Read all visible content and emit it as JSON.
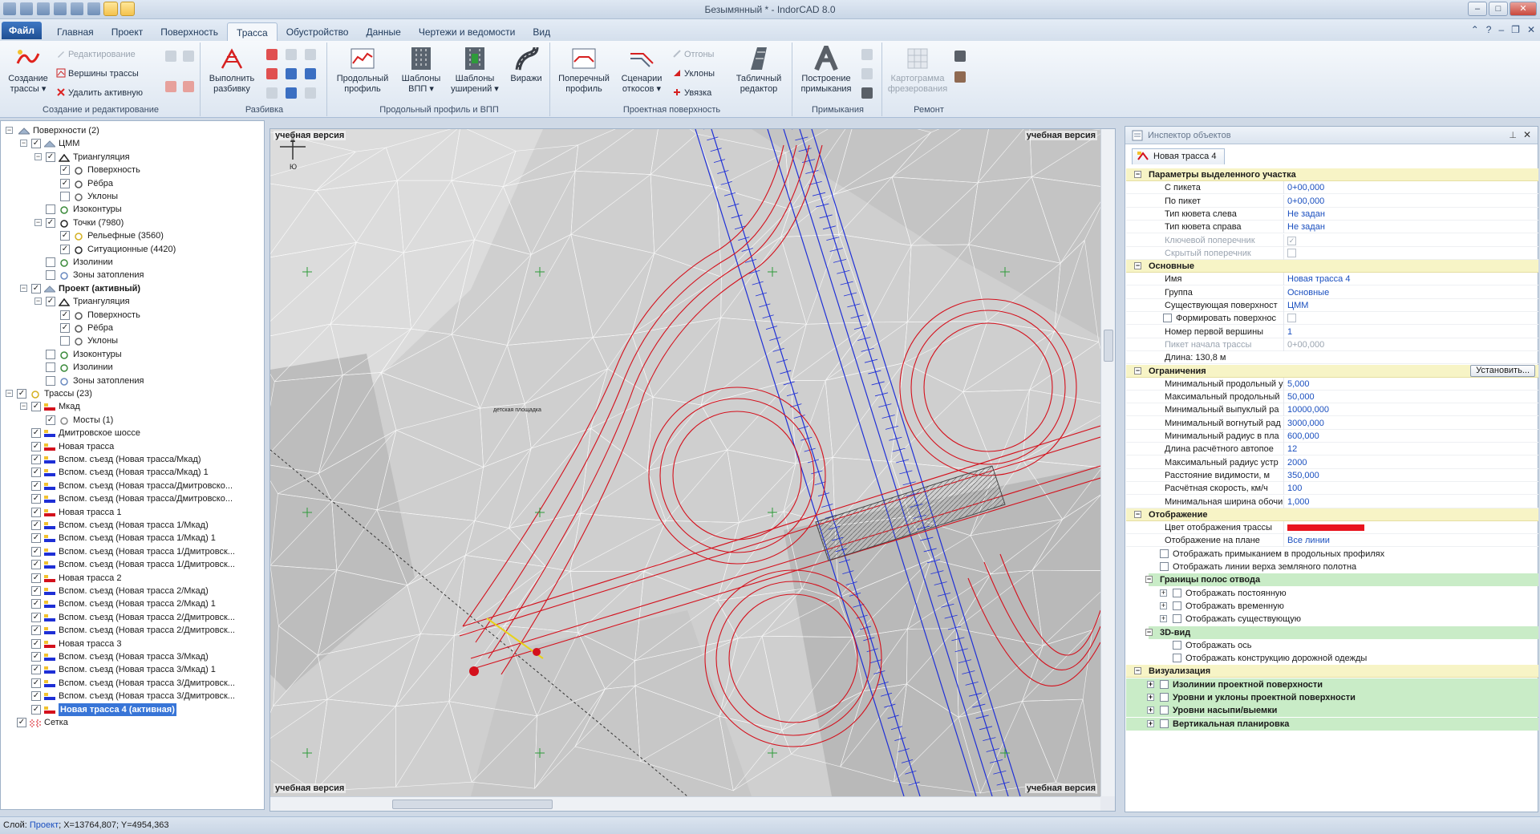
{
  "window": {
    "title": "Безымянный * - IndorCAD 8.0"
  },
  "menu": {
    "file": "Файл",
    "tabs": [
      "Главная",
      "Проект",
      "Поверхность",
      "Трасса",
      "Обустройство",
      "Данные",
      "Чертежи и ведомости",
      "Вид"
    ],
    "active": "Трасса"
  },
  "ribbon": {
    "g1": {
      "label": "Создание и редактирование",
      "create": "Создание трассы",
      "create_arrow": "▾",
      "edit": "Редактирование",
      "vertices": "Вершины трассы",
      "delete": "Удалить активную"
    },
    "g2": {
      "label": "Разбивка",
      "run": "Выполнить разбивку"
    },
    "g3": {
      "label": "Продольный профиль и ВПП",
      "long": "Продольный профиль",
      "tmpl_vpp": "Шаблоны ВПП",
      "tmpl_wide": "Шаблоны уширений",
      "turns": "Виражи"
    },
    "g4": {
      "label": "Проектная поверхность",
      "cross": "Поперечный профиль",
      "scenario": "Сценарии откосов",
      "otgony": "Отгоны",
      "uklony": "Уклоны",
      "uvyazka": "Увязка",
      "table": "Табличный редактор"
    },
    "g5": {
      "label": "Примыкания",
      "build": "Построение примыкания"
    },
    "g6": {
      "label": "Ремонт",
      "carto": "Картограмма фрезерования"
    }
  },
  "tree": [
    {
      "level": 0,
      "exp": "-",
      "cb": "",
      "icon": "surface",
      "label": "Поверхности (2)"
    },
    {
      "level": 1,
      "exp": "-",
      "cb": "✓",
      "icon": "dtm",
      "label": "ЦММ"
    },
    {
      "level": 2,
      "exp": "-",
      "cb": "✓",
      "icon": "tri",
      "label": "Триангуляция"
    },
    {
      "level": 3,
      "exp": "",
      "cb": "✓",
      "icon": "surf",
      "label": "Поверхность"
    },
    {
      "level": 3,
      "exp": "",
      "cb": "✓",
      "icon": "edges",
      "label": "Рёбра"
    },
    {
      "level": 3,
      "exp": "",
      "cb": "",
      "icon": "slopes",
      "label": "Уклоны"
    },
    {
      "level": 2,
      "exp": "",
      "cb": "",
      "icon": "contour",
      "label": "Изоконтуры"
    },
    {
      "level": 2,
      "exp": "-",
      "cb": "✓",
      "icon": "points",
      "label": "Точки (7980)"
    },
    {
      "level": 3,
      "exp": "",
      "cb": "✓",
      "icon": "relief",
      "label": "Рельефные (3560)"
    },
    {
      "level": 3,
      "exp": "",
      "cb": "✓",
      "icon": "situation",
      "label": "Ситуационные (4420)"
    },
    {
      "level": 2,
      "exp": "",
      "cb": "",
      "icon": "contour",
      "label": "Изолинии"
    },
    {
      "level": 2,
      "exp": "",
      "cb": "",
      "icon": "flood",
      "label": "Зоны затопления"
    },
    {
      "level": 1,
      "exp": "-",
      "cb": "✓",
      "icon": "dtm",
      "label": "Проект (активный)",
      "bold": true
    },
    {
      "level": 2,
      "exp": "-",
      "cb": "✓",
      "icon": "tri",
      "label": "Триангуляция"
    },
    {
      "level": 3,
      "exp": "",
      "cb": "✓",
      "icon": "surf",
      "label": "Поверхность"
    },
    {
      "level": 3,
      "exp": "",
      "cb": "✓",
      "icon": "edges",
      "label": "Рёбра"
    },
    {
      "level": 3,
      "exp": "",
      "cb": "",
      "icon": "slopes",
      "label": "Уклоны"
    },
    {
      "level": 2,
      "exp": "",
      "cb": "",
      "icon": "contour",
      "label": "Изоконтуры"
    },
    {
      "level": 2,
      "exp": "",
      "cb": "",
      "icon": "contour",
      "label": "Изолинии"
    },
    {
      "level": 2,
      "exp": "",
      "cb": "",
      "icon": "flood",
      "label": "Зоны затопления"
    },
    {
      "level": 0,
      "exp": "-",
      "cb": "✓",
      "icon": "roads",
      "label": "Трассы (23)"
    },
    {
      "level": 1,
      "exp": "-",
      "cb": "✓",
      "icon": "road-red",
      "label": "Мкад"
    },
    {
      "level": 2,
      "exp": "",
      "cb": "✓",
      "icon": "bridge",
      "label": "Мосты (1)"
    },
    {
      "level": 1,
      "exp": "",
      "cb": "✓",
      "icon": "road-blue",
      "label": "Дмитровское шоссе"
    },
    {
      "level": 1,
      "exp": "",
      "cb": "✓",
      "icon": "road-red",
      "label": "Новая трасса"
    },
    {
      "level": 1,
      "exp": "",
      "cb": "✓",
      "icon": "road-blue",
      "label": "Вспом. съезд (Новая трасса/Мкад)"
    },
    {
      "level": 1,
      "exp": "",
      "cb": "✓",
      "icon": "road-blue",
      "label": "Вспом. съезд (Новая трасса/Мкад) 1"
    },
    {
      "level": 1,
      "exp": "",
      "cb": "✓",
      "icon": "road-blue",
      "label": "Вспом. съезд (Новая трасса/Дмитровско..."
    },
    {
      "level": 1,
      "exp": "",
      "cb": "✓",
      "icon": "road-blue",
      "label": "Вспом. съезд (Новая трасса/Дмитровско..."
    },
    {
      "level": 1,
      "exp": "",
      "cb": "✓",
      "icon": "road-red",
      "label": "Новая трасса 1"
    },
    {
      "level": 1,
      "exp": "",
      "cb": "✓",
      "icon": "road-blue",
      "label": "Вспом. съезд (Новая трасса 1/Мкад)"
    },
    {
      "level": 1,
      "exp": "",
      "cb": "✓",
      "icon": "road-blue",
      "label": "Вспом. съезд (Новая трасса 1/Мкад) 1"
    },
    {
      "level": 1,
      "exp": "",
      "cb": "✓",
      "icon": "road-blue",
      "label": "Вспом. съезд (Новая трасса 1/Дмитровск..."
    },
    {
      "level": 1,
      "exp": "",
      "cb": "✓",
      "icon": "road-blue",
      "label": "Вспом. съезд (Новая трасса 1/Дмитровск..."
    },
    {
      "level": 1,
      "exp": "",
      "cb": "✓",
      "icon": "road-red",
      "label": "Новая трасса 2"
    },
    {
      "level": 1,
      "exp": "",
      "cb": "✓",
      "icon": "road-blue",
      "label": "Вспом. съезд (Новая трасса 2/Мкад)"
    },
    {
      "level": 1,
      "exp": "",
      "cb": "✓",
      "icon": "road-blue",
      "label": "Вспом. съезд (Новая трасса 2/Мкад) 1"
    },
    {
      "level": 1,
      "exp": "",
      "cb": "✓",
      "icon": "road-blue",
      "label": "Вспом. съезд (Новая трасса 2/Дмитровск..."
    },
    {
      "level": 1,
      "exp": "",
      "cb": "✓",
      "icon": "road-blue",
      "label": "Вспом. съезд (Новая трасса 2/Дмитровск..."
    },
    {
      "level": 1,
      "exp": "",
      "cb": "✓",
      "icon": "road-red",
      "label": "Новая трасса 3"
    },
    {
      "level": 1,
      "exp": "",
      "cb": "✓",
      "icon": "road-blue",
      "label": "Вспом. съезд (Новая трасса 3/Мкад)"
    },
    {
      "level": 1,
      "exp": "",
      "cb": "✓",
      "icon": "road-blue",
      "label": "Вспом. съезд (Новая трасса 3/Мкад) 1"
    },
    {
      "level": 1,
      "exp": "",
      "cb": "✓",
      "icon": "road-blue",
      "label": "Вспом. съезд (Новая трасса 3/Дмитровск..."
    },
    {
      "level": 1,
      "exp": "",
      "cb": "✓",
      "icon": "road-blue",
      "label": "Вспом. съезд (Новая трасса 3/Дмитровск..."
    },
    {
      "level": 1,
      "exp": "",
      "cb": "✓",
      "icon": "road-red",
      "label": "Новая трасса 4 (активная)",
      "selected": true
    },
    {
      "level": 0,
      "exp": "",
      "cb": "✓",
      "icon": "grid",
      "label": "Сетка"
    }
  ],
  "map": {
    "watermark": "учебная версия",
    "compass": "Ю",
    "label_square": "детская площадка"
  },
  "inspector": {
    "title": "Инспектор объектов",
    "doc_tab": "Новая трасса 4",
    "set_button": "Установить...",
    "rows": [
      {
        "t": "cat",
        "label": "Параметры выделенного участка"
      },
      {
        "t": "prop",
        "name": "С пикета",
        "value": "0+00,000"
      },
      {
        "t": "prop",
        "name": "По пикет",
        "value": "0+00,000"
      },
      {
        "t": "prop",
        "name": "Тип кювета слева",
        "value": "Не задан"
      },
      {
        "t": "prop",
        "name": "Тип кювета справа",
        "value": "Не задан"
      },
      {
        "t": "prop",
        "name": "Ключевой поперечник",
        "value": "",
        "check": "✓",
        "dis": true
      },
      {
        "t": "prop",
        "name": "Скрытый поперечник",
        "value": "",
        "check": "",
        "dis": true
      },
      {
        "t": "cat",
        "label": "Основные"
      },
      {
        "t": "prop",
        "name": "Имя",
        "value": "Новая трасса 4"
      },
      {
        "t": "prop",
        "name": "Группа",
        "value": "Основные"
      },
      {
        "t": "prop",
        "name": "Существующая поверхност",
        "value": "ЦММ"
      },
      {
        "t": "prop",
        "name": "Формировать поверхнос",
        "value": "",
        "check": "",
        "pre": true
      },
      {
        "t": "prop",
        "name": "Номер первой вершины",
        "value": "1"
      },
      {
        "t": "prop",
        "name": "Пикет начала трассы",
        "value": "0+00,000",
        "dis": true
      },
      {
        "t": "prop",
        "name": "Длина: 130,8 м",
        "value": ""
      },
      {
        "t": "cat",
        "label": "Ограничения",
        "button": true
      },
      {
        "t": "prop",
        "name": "Минимальный продольный у",
        "value": "5,000"
      },
      {
        "t": "prop",
        "name": "Максимальный продольный",
        "value": "50,000"
      },
      {
        "t": "prop",
        "name": "Минимальный выпуклый ра",
        "value": "10000,000"
      },
      {
        "t": "prop",
        "name": "Минимальный вогнутый рад",
        "value": "3000,000"
      },
      {
        "t": "prop",
        "name": "Минимальный радиус в пла",
        "value": "600,000"
      },
      {
        "t": "prop",
        "name": "Длина расчётного автопое",
        "value": "12"
      },
      {
        "t": "prop",
        "name": "Максимальный радиус устр",
        "value": "2000"
      },
      {
        "t": "prop",
        "name": "Расстояние видимости, м",
        "value": "350,000"
      },
      {
        "t": "prop",
        "name": "Расчётная скорость, км/ч",
        "value": "100"
      },
      {
        "t": "prop",
        "name": "Минимальная ширина обочи",
        "value": "1,000"
      },
      {
        "t": "cat",
        "label": "Отображение"
      },
      {
        "t": "prop",
        "name": "Цвет отображения трассы",
        "value": "",
        "color": "#e8141e"
      },
      {
        "t": "prop",
        "name": "Отображение на плане",
        "value": "Все линии"
      },
      {
        "t": "check",
        "label": "Отображать примыканием в продольных профилях",
        "indent": 1
      },
      {
        "t": "check",
        "label": "Отображать линии верха земляного полотна",
        "indent": 1
      },
      {
        "t": "sub",
        "label": "Границы полос отвода"
      },
      {
        "t": "check",
        "label": "Отображать постоянную",
        "indent": 2,
        "exp": "+"
      },
      {
        "t": "check",
        "label": "Отображать временную",
        "indent": 2,
        "exp": "+"
      },
      {
        "t": "check",
        "label": "Отображать существующую",
        "indent": 2,
        "exp": "+"
      },
      {
        "t": "sub",
        "label": "3D-вид"
      },
      {
        "t": "check",
        "label": "Отображать ось",
        "indent": 2
      },
      {
        "t": "check",
        "label": "Отображать конструкцию дорожной одежды",
        "indent": 2
      },
      {
        "t": "cat",
        "label": "Визуализация"
      },
      {
        "t": "check",
        "label": "Изолинии проектной поверхности",
        "indent": 1,
        "exp": "+",
        "green": true
      },
      {
        "t": "check",
        "label": "Уровни и уклоны проектной поверхности",
        "indent": 1,
        "exp": "+",
        "green": true
      },
      {
        "t": "check",
        "label": "Уровни насыпи/выемки",
        "indent": 1,
        "exp": "+",
        "green": true
      },
      {
        "t": "check",
        "label": "Вертикальная планировка",
        "indent": 1,
        "exp": "+",
        "green": true
      }
    ]
  },
  "status": {
    "prefix": "Слой:",
    "layer": "Проект",
    "coords": "; X=13764,807; Y=4954,363"
  }
}
